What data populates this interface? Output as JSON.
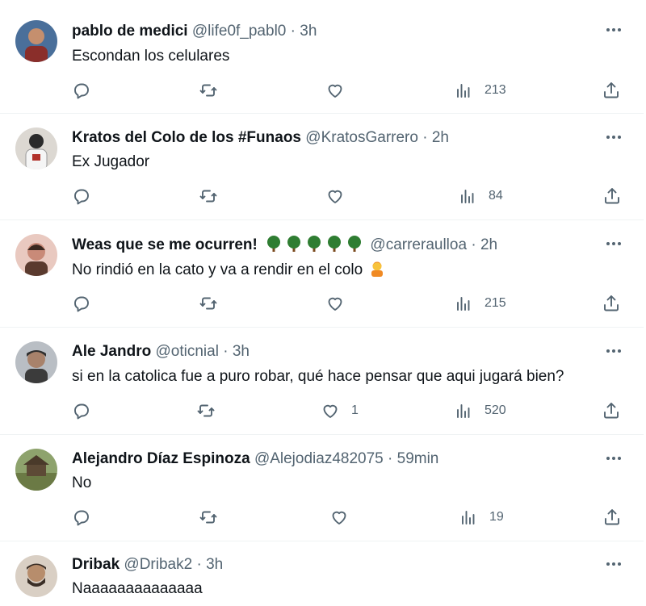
{
  "tweets": [
    {
      "name": "pablo de medici",
      "handle": "@life0f_pabl0",
      "sep": "·",
      "time": "3h",
      "text": "Escondan los celulares",
      "likes": "",
      "views": "213",
      "avatar_colors": [
        "#7a3b2a",
        "#2b2d3a"
      ]
    },
    {
      "name": "Kratos del Colo de los #Funaos",
      "handle": "@KratosGarrero",
      "sep": "·",
      "time": "2h",
      "text": "Ex Jugador",
      "likes": "",
      "views": "84",
      "avatar_colors": [
        "#e8e4df",
        "#2a2a2a"
      ]
    },
    {
      "name": "Weas que se me ocurren!",
      "name_emoji": "tree-emoji x5",
      "handle": "@carreraulloa",
      "sep": "·",
      "time": "2h",
      "text": "No rindió en la cato y va a rendir en el colo",
      "text_emoji": "person-gesturing-emoji",
      "likes": "",
      "views": "215",
      "avatar_colors": [
        "#c98a78",
        "#5a3a2e"
      ]
    },
    {
      "name": "Ale Jandro",
      "handle": "@oticnial",
      "sep": "·",
      "time": "3h",
      "text": "si en la catolica fue a puro robar, qué hace pensar que aqui jugará bien?",
      "likes": "1",
      "views": "520",
      "avatar_colors": [
        "#9aa0a6",
        "#3b3b3b"
      ]
    },
    {
      "name": "Alejandro Díaz Espinoza",
      "handle": "@Alejodiaz482075",
      "sep": "·",
      "time": "59min",
      "text": "No",
      "likes": "",
      "views": "19",
      "avatar_colors": [
        "#7b8f5c",
        "#5d4a36"
      ]
    },
    {
      "name": "Dribak",
      "handle": "@Dribak2",
      "sep": "·",
      "time": "3h",
      "text": "Naaaaaaaaaaaaaa",
      "likes": "",
      "views": "",
      "avatar_colors": [
        "#d9cfc4",
        "#3a2e26"
      ]
    }
  ],
  "colors": {
    "text": "#0f1419",
    "secondary": "#536471",
    "divider": "#eff3f4",
    "tree_leaf": "#2f7d32",
    "tree_trunk": "#7a4a1e"
  }
}
